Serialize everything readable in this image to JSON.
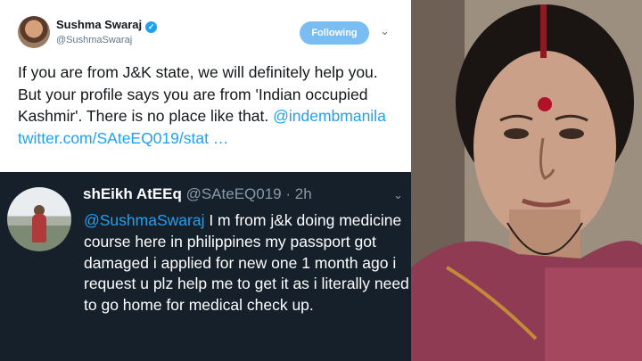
{
  "top_tweet": {
    "author_name": "Sushma Swaraj",
    "verified_icon": "verified-badge-icon",
    "handle": "@SushmaSwaraj",
    "follow_label": "Following",
    "text": "If you are from J&K state, we will definitely help you. But your profile says you are from 'Indian occupied Kashmir'. There is no place like that.",
    "mention": "@indembmanila",
    "link": "twitter.com/SAteEQ019/stat …"
  },
  "bottom_tweet": {
    "author_name": "shEikh AtEEq",
    "handle": "@SAteEQ019",
    "time": "· 2h",
    "mention": "@SushmaSwaraj",
    "text": " I m from j&k doing medicine course here in philippines  my passport got damaged i applied for new one 1 month ago i request u plz help me to get it as i literally need to go home for medical check up."
  },
  "colors": {
    "twitter_blue": "#1da1f2",
    "following_button": "#79bdf2",
    "dark_bg": "#15202b",
    "bindi_red": "#b0122a"
  }
}
